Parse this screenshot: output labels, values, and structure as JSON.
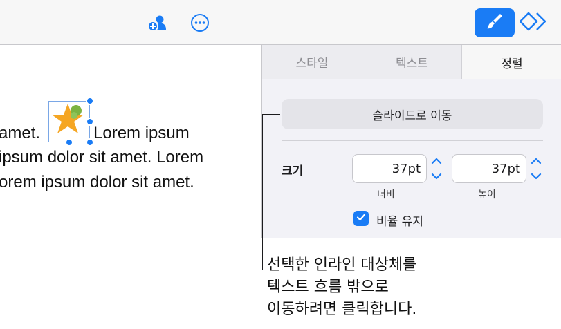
{
  "toolbar": {
    "collaborate_icon": "add-person-icon",
    "more_icon": "ellipsis-icon",
    "format_icon": "paintbrush-icon",
    "animate_icon": "diamond-animate-icon"
  },
  "document": {
    "lines": [
      {
        "before": "amet.",
        "after": "Lorem ipsum"
      },
      {
        "text": "ipsum dolor sit amet. Lorem"
      },
      {
        "text": "orem ipsum dolor sit amet."
      }
    ],
    "inline_object": "star-shape",
    "star_color": "#f5a623",
    "accent_circle_color": "#7cb342"
  },
  "inspector": {
    "tabs": [
      "스타일",
      "텍스트",
      "정렬"
    ],
    "selected_tab": "정렬",
    "move_to_slide_label": "슬라이드로 이동",
    "size_label": "크기",
    "width_value": "37pt",
    "height_value": "37pt",
    "width_caption": "너비",
    "height_caption": "높이",
    "keep_ratio_label": "비율 유지",
    "keep_ratio_checked": true
  },
  "callout": {
    "lines": [
      "선택한 인라인 대상체를",
      "텍스트 흐름 밖으로",
      "이동하려면 클릭합니다."
    ]
  },
  "colors": {
    "accent": "#1a7cf5"
  }
}
